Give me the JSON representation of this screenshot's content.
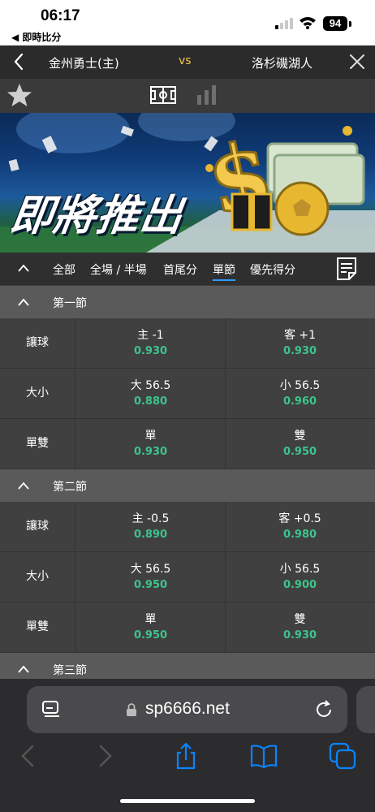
{
  "status_bar": {
    "time": "06:17",
    "back_label": "◀ 即時比分",
    "battery": "94"
  },
  "match": {
    "home": "金州勇士(主)",
    "vs": "vs",
    "away": "洛杉磯湖人"
  },
  "banner": {
    "headline": "即將推出"
  },
  "tabs": [
    {
      "label": "全部",
      "active": false
    },
    {
      "label": "全場 / 半場",
      "active": false
    },
    {
      "label": "首尾分",
      "active": false
    },
    {
      "label": "單節",
      "active": true
    },
    {
      "label": "優先得分",
      "active": false
    }
  ],
  "periods": [
    {
      "title": "第一節",
      "rows": [
        {
          "label": "讓球",
          "left": {
            "name": "主 -1",
            "odds": "0.930"
          },
          "right": {
            "name": "客 +1",
            "odds": "0.930"
          }
        },
        {
          "label": "大小",
          "left": {
            "name": "大 56.5",
            "odds": "0.880"
          },
          "right": {
            "name": "小 56.5",
            "odds": "0.960"
          }
        },
        {
          "label": "單雙",
          "left": {
            "name": "單",
            "odds": "0.930"
          },
          "right": {
            "name": "雙",
            "odds": "0.950"
          }
        }
      ]
    },
    {
      "title": "第二節",
      "rows": [
        {
          "label": "讓球",
          "left": {
            "name": "主 -0.5",
            "odds": "0.890"
          },
          "right": {
            "name": "客 +0.5",
            "odds": "0.980"
          }
        },
        {
          "label": "大小",
          "left": {
            "name": "大 56.5",
            "odds": "0.950"
          },
          "right": {
            "name": "小 56.5",
            "odds": "0.900"
          }
        },
        {
          "label": "單雙",
          "left": {
            "name": "單",
            "odds": "0.950"
          },
          "right": {
            "name": "雙",
            "odds": "0.930"
          }
        }
      ]
    },
    {
      "title": "第三節",
      "rows": []
    }
  ],
  "browser": {
    "url": "sp6666.net"
  },
  "colors": {
    "odds": "#3cc48c",
    "vs": "#f2c94c",
    "active_tab": "#2e9cff",
    "ios_blue": "#0a84ff"
  }
}
